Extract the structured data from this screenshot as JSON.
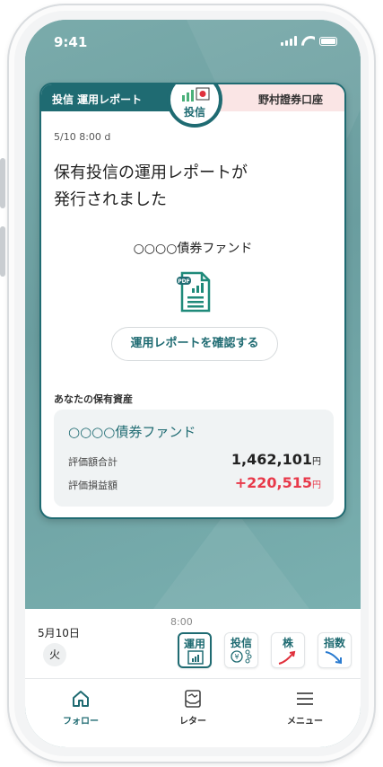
{
  "status_bar": {
    "time": "9:41"
  },
  "card": {
    "tab_left": "投信 運用レポート",
    "badge_label": "投信",
    "tab_right": "野村證券口座",
    "timestamp": "5/10 8:00 d",
    "headline_line1": "保有投信の運用レポートが",
    "headline_line2": "発行されました",
    "fund_title": "○○○○債券ファンド",
    "pdf_icon": "pdf-document-icon",
    "report_button": "運用レポートを確認する",
    "holdings_label": "あなたの保有資産",
    "holding": {
      "fund": "○○○○債券ファンド",
      "valuation_label": "評価額合計",
      "valuation_value": "1,462,101",
      "valuation_unit": "円",
      "pnl_label": "評価損益額",
      "pnl_value": "+220,515",
      "pnl_unit": "円"
    }
  },
  "ticker": {
    "time": "8:00",
    "date_month_day": "5月10日",
    "day_of_week": "火",
    "chips": [
      {
        "label": "運用",
        "icon": "report-chart-icon",
        "active": true
      },
      {
        "label": "投信",
        "icon": "yen-network-icon",
        "active": false
      },
      {
        "label": "株",
        "icon": "trend-up-icon",
        "active": false
      },
      {
        "label": "指数",
        "icon": "trend-down-icon",
        "active": false
      }
    ]
  },
  "bottom_nav": [
    {
      "label": "フォロー",
      "icon": "home-icon",
      "active": true
    },
    {
      "label": "レター",
      "icon": "letter-icon",
      "active": false
    },
    {
      "label": "メニュー",
      "icon": "menu-icon",
      "active": false
    }
  ],
  "colors": {
    "accent": "#1f6b72",
    "positive": "#e8394a",
    "background_teal": "#6fa0a2",
    "tab_pink": "#fae5e5"
  }
}
